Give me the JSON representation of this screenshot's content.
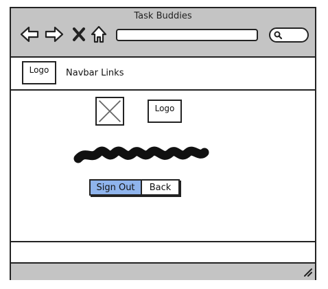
{
  "window": {
    "title": "Task Buddies"
  },
  "browser": {
    "icons": [
      "back-arrow-icon",
      "forward-arrow-icon",
      "close-x-icon",
      "home-icon",
      "search-icon"
    ],
    "address_value": "",
    "search_value": ""
  },
  "navbar": {
    "logo_label": "Logo",
    "links_label": "Navbar Links"
  },
  "content": {
    "logo_label": "Logo",
    "buttons": {
      "sign_out": "Sign Out",
      "back": "Back"
    }
  },
  "colors": {
    "chrome": "#c4c4c4",
    "primary_button": "#8fb4ec",
    "outline": "#222222"
  }
}
